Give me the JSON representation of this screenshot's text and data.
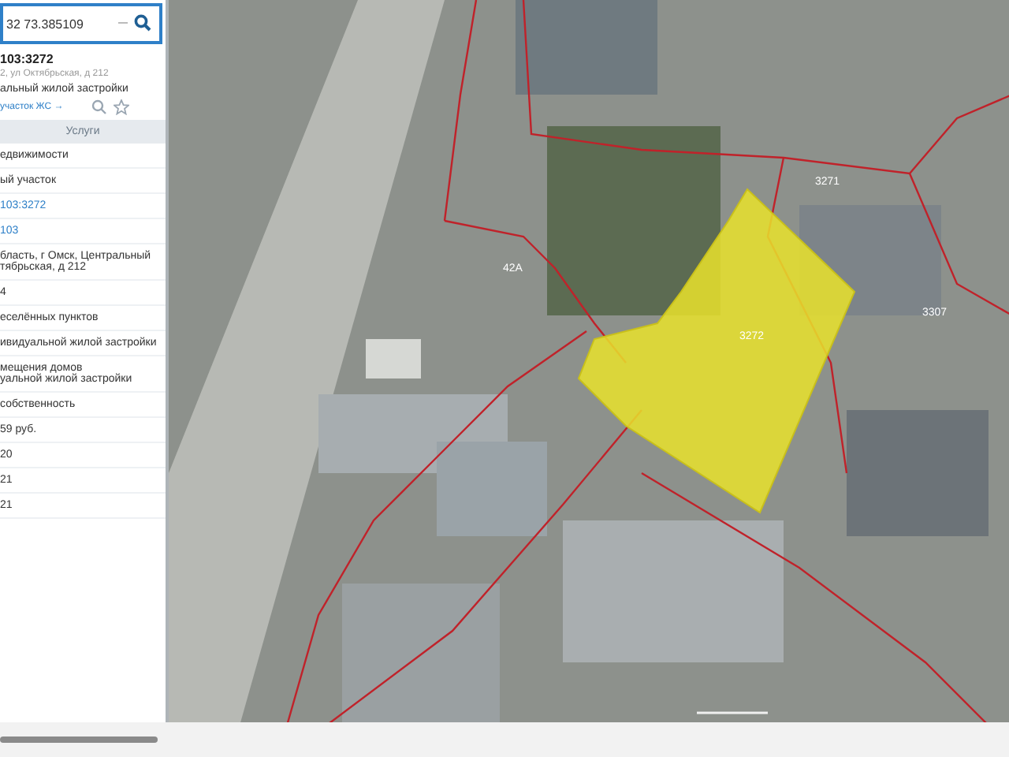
{
  "search": {
    "value": "32 73.385109"
  },
  "card": {
    "number": "103:3272",
    "address": "2, ул Октябрьская, д 212",
    "purpose": "альный жилой застройки",
    "link": "участок ЖС →"
  },
  "tab": {
    "label": "Услуги"
  },
  "rows": [
    {
      "lines": [
        "едвижимости"
      ],
      "kind": "plain"
    },
    {
      "lines": [
        "ый участок"
      ],
      "kind": "plain"
    },
    {
      "lines": [
        "103:3272"
      ],
      "kind": "link"
    },
    {
      "lines": [
        "103"
      ],
      "kind": "link"
    },
    {
      "lines": [
        "бласть, г Омск, Центральный",
        "тябрьская, д 212"
      ],
      "kind": "plain"
    },
    {
      "lines": [
        "4"
      ],
      "kind": "plain"
    },
    {
      "lines": [
        "еселённых пунктов"
      ],
      "kind": "plain"
    },
    {
      "lines": [
        "ивидуальной жилой застройки"
      ],
      "kind": "plain"
    },
    {
      "lines": [
        "мещения домов",
        "уальной жилой застройки"
      ],
      "kind": "plain"
    },
    {
      "lines": [
        "собственность"
      ],
      "kind": "plain"
    },
    {
      "lines": [
        "59 руб."
      ],
      "kind": "plain"
    },
    {
      "lines": [
        "20"
      ],
      "kind": "plain"
    },
    {
      "lines": [
        "21"
      ],
      "kind": "plain"
    },
    {
      "lines": [
        "21"
      ],
      "kind": "plain"
    }
  ],
  "map": {
    "labels": [
      "42А",
      "3272",
      "3271",
      "3307"
    ]
  }
}
